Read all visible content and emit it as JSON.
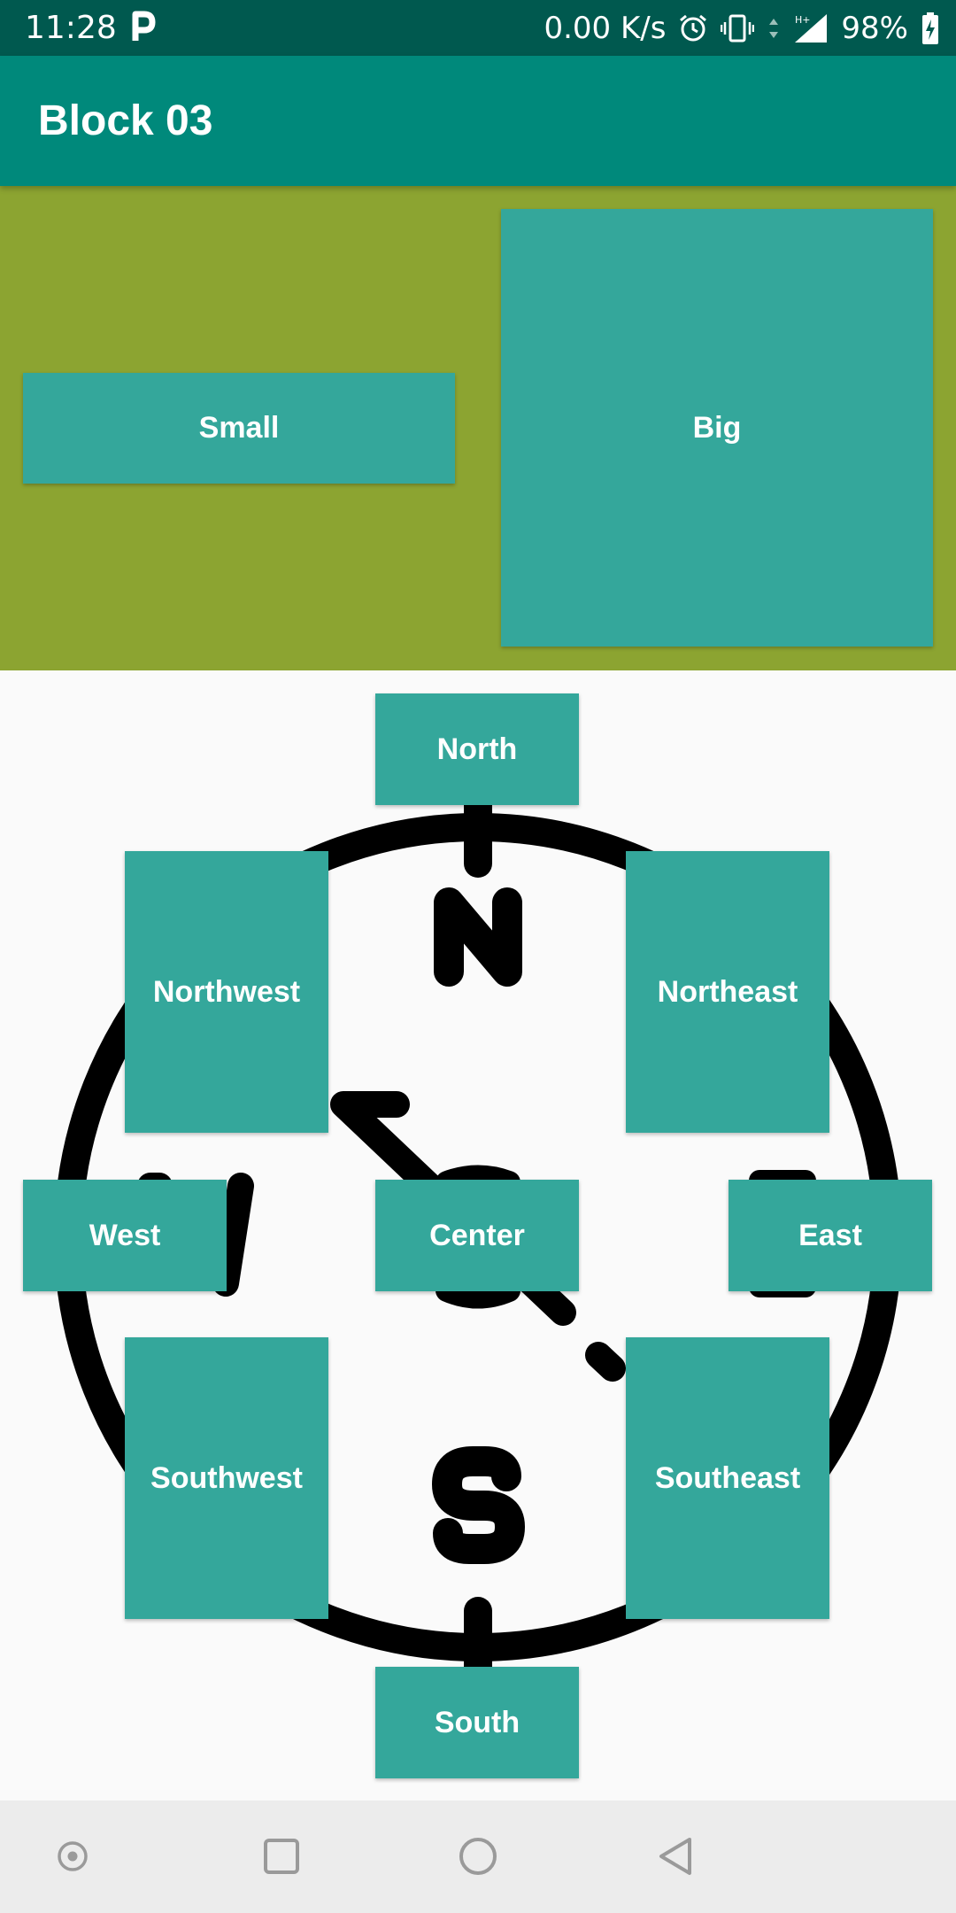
{
  "status_bar": {
    "time": "11:28",
    "net_speed": "0.00 K/s",
    "battery": "98%",
    "icons": [
      "parking-icon",
      "alarm-icon",
      "vibrate-icon",
      "data-arrows-icon",
      "signal-icon",
      "battery-charging-icon"
    ]
  },
  "app_bar": {
    "title": "Block 03"
  },
  "top_block": {
    "small_label": "Small",
    "big_label": "Big"
  },
  "compass": {
    "north": "North",
    "northwest": "Northwest",
    "northeast": "Northeast",
    "west": "West",
    "center": "Center",
    "east": "East",
    "southwest": "Southwest",
    "southeast": "Southeast",
    "south": "South"
  },
  "nav_bar": {
    "icons": [
      "assistant-dot-icon",
      "recents-square-icon",
      "home-circle-icon",
      "back-triangle-icon"
    ]
  },
  "colors": {
    "status_bar": "#00594f",
    "app_bar": "#00897b",
    "top_block_bg": "#8ca431",
    "tile": "#34a79b",
    "compass_bg": "#fafafa",
    "nav_bar": "#ececec"
  }
}
